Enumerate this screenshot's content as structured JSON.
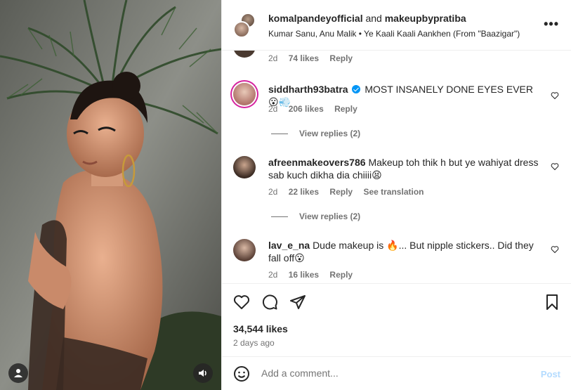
{
  "header": {
    "user1": "komalpandeyofficial",
    "and_text": " and ",
    "user2": "makeupbypratiba",
    "audio": "Kumar Sanu, Anu Malik • Ye Kaali Kaali Aankhen (From \"Baazigar\")",
    "more": "•••"
  },
  "comments": [
    {
      "meta": {
        "time": "2d",
        "likes": "74 likes",
        "reply": "Reply"
      }
    },
    {
      "user": "siddharth93batra",
      "text": "MOST INSANELY DONE EYES EVER",
      "emoji": "😮💨",
      "meta": {
        "time": "2d",
        "likes": "206 likes",
        "reply": "Reply"
      },
      "view_replies": "View replies (2)"
    },
    {
      "user": "afreenmakeovers786",
      "text": "Makeup toh thik h but ye wahiyat dress sab kuch dikha dia chiiii",
      "emoji": "😫",
      "meta": {
        "time": "2d",
        "likes": "22 likes",
        "reply": "Reply",
        "translate": "See translation"
      },
      "view_replies": "View replies (2)"
    },
    {
      "user": "lav_e_na",
      "text_before": "Dude makeup is",
      "emoji_mid": "🔥",
      "text_after": "... But nipple stickers.. Did they fall off",
      "emoji": "😮",
      "meta": {
        "time": "2d",
        "likes": "16 likes",
        "reply": "Reply"
      }
    }
  ],
  "actions": {
    "likes": "34,544 likes",
    "ago": "2 days ago"
  },
  "add_comment": {
    "placeholder": "Add a comment...",
    "post": "Post"
  },
  "icons": {
    "like": "heart-icon",
    "comment": "comment-icon",
    "share": "share-icon",
    "save": "bookmark-icon",
    "emoji": "emoji-icon",
    "tag": "person-icon",
    "sound": "speaker-icon"
  },
  "colors": {
    "link_blue": "#0095f6",
    "post_disabled": "#b3dbff",
    "muted": "#737373"
  }
}
